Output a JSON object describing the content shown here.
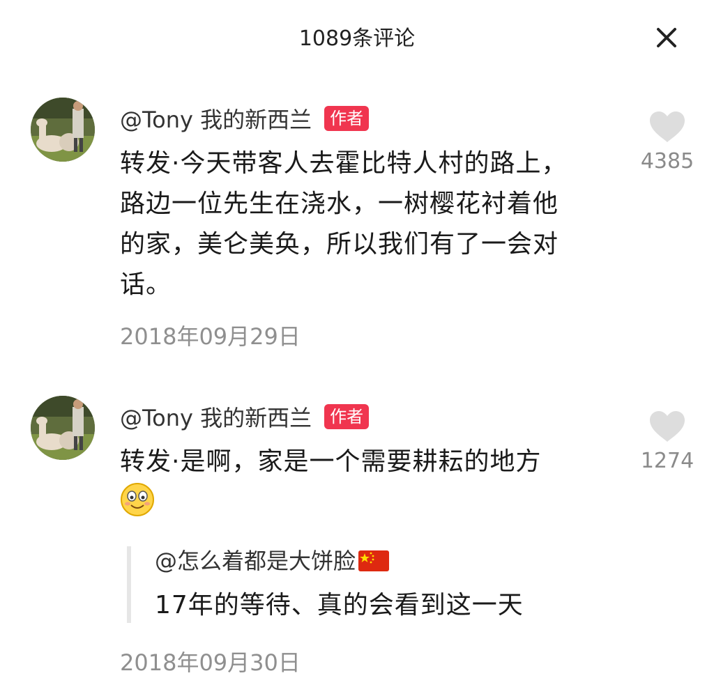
{
  "header": {
    "title": "1089条评论"
  },
  "comments": [
    {
      "author": "@Tony 我的新西兰",
      "badge": "作者",
      "text": "转发·今天带客人去霍比特人村的路上，路边一位先生在浇水，一树樱花衬着他的家，美仑美奂，所以我们有了一会对话。",
      "date": "2018年09月29日",
      "likes": "4385"
    },
    {
      "author": "@Tony 我的新西兰",
      "badge": "作者",
      "text": "转发·是啊，家是一个需要耕耘的地方",
      "date": "2018年09月30日",
      "likes": "1274",
      "reply": {
        "author": "@怎么着都是大饼脸",
        "text": "17年的等待、真的会看到这一天"
      }
    }
  ],
  "colors": {
    "badge": "#f0354f",
    "muted": "#8f8f8f",
    "heart": "#dddddd"
  }
}
